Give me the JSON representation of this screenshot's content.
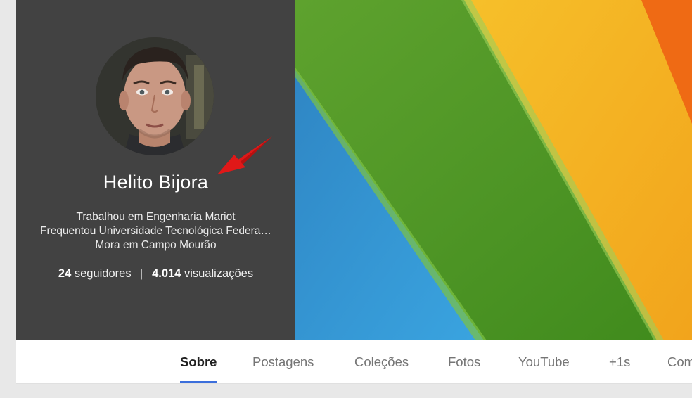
{
  "profile": {
    "name": "Helito Bijora",
    "work": "Trabalhou em Engenharia Mariot",
    "education": "Frequentou Universidade Tecnológica Federa…",
    "location": "Mora em Campo Mourão",
    "followers_count": "24",
    "followers_label": "seguidores",
    "separator": "|",
    "views_count": "4.014",
    "views_label": "visualizações"
  },
  "tabs": [
    {
      "label": "Sobre",
      "active": true
    },
    {
      "label": "Postagens",
      "active": false
    },
    {
      "label": "Coleções",
      "active": false
    },
    {
      "label": "Fotos",
      "active": false
    },
    {
      "label": "YouTube",
      "active": false
    },
    {
      "label": "+1s",
      "active": false
    },
    {
      "label": "Com",
      "active": false
    }
  ],
  "colors": {
    "panel": "#424242",
    "accent": "#3c6fdc",
    "arrow": "#e01818"
  }
}
